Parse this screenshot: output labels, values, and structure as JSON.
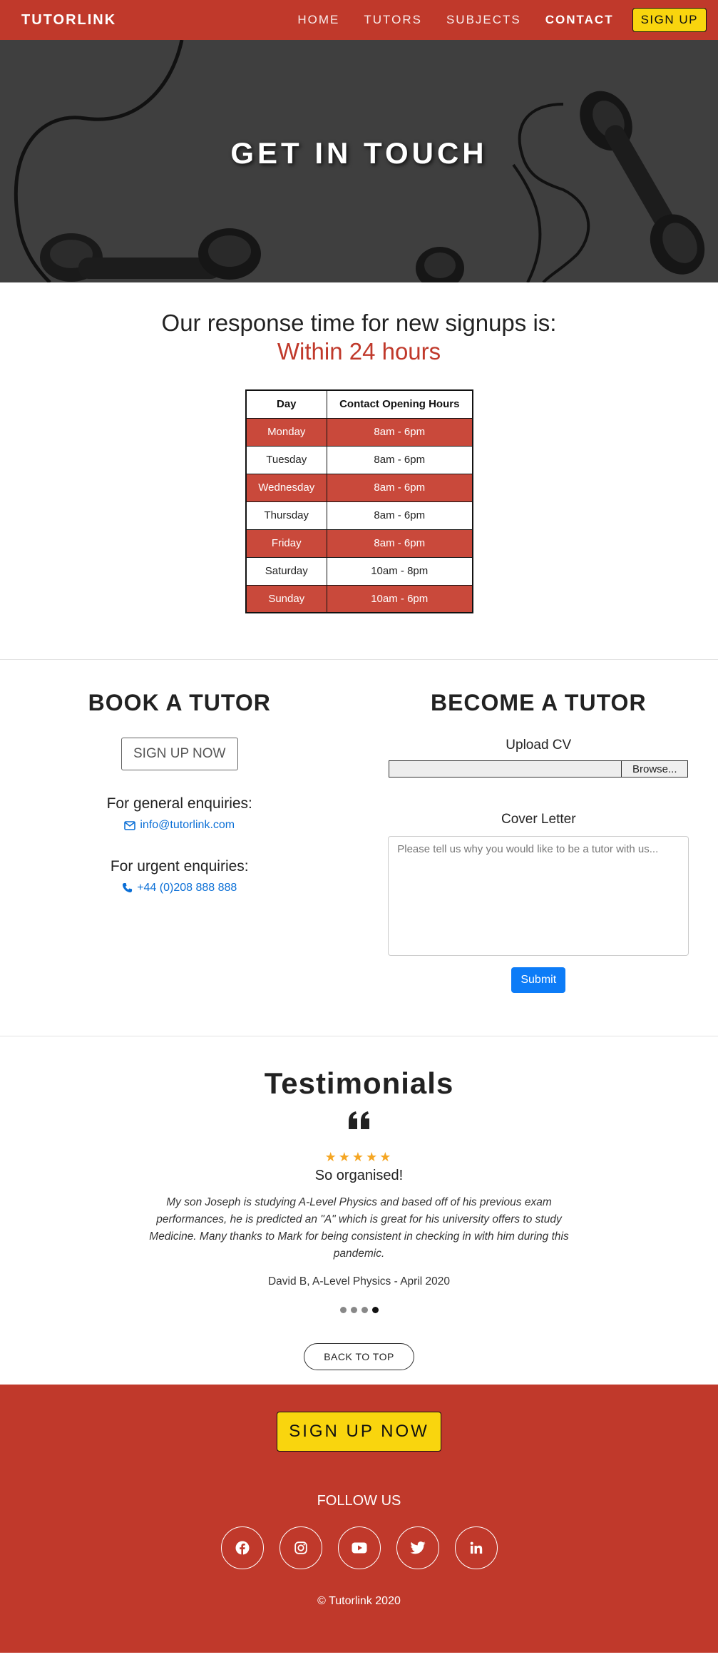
{
  "nav": {
    "brand": "TUTORLINK",
    "links": [
      "HOME",
      "TUTORS",
      "SUBJECTS",
      "CONTACT"
    ],
    "active": "CONTACT",
    "signup": "SIGN UP"
  },
  "hero": {
    "title": "GET IN TOUCH"
  },
  "response": {
    "line1": "Our response time for new signups is:",
    "line2": "Within 24 hours"
  },
  "hours_table": {
    "headers": [
      "Day",
      "Contact Opening Hours"
    ],
    "rows": [
      [
        "Monday",
        "8am - 6pm"
      ],
      [
        "Tuesday",
        "8am - 6pm"
      ],
      [
        "Wednesday",
        "8am - 6pm"
      ],
      [
        "Thursday",
        "8am - 6pm"
      ],
      [
        "Friday",
        "8am - 6pm"
      ],
      [
        "Saturday",
        "10am - 8pm"
      ],
      [
        "Sunday",
        "10am - 6pm"
      ]
    ]
  },
  "book": {
    "title": "BOOK A TUTOR",
    "button": "SIGN UP NOW",
    "general_label": "For general enquiries:",
    "email": "info@tutorlink.com",
    "urgent_label": "For urgent enquiries:",
    "phone": "+44 (0)208 888 888"
  },
  "become": {
    "title": "BECOME A TUTOR",
    "upload_label": "Upload CV",
    "browse": "Browse...",
    "cover_label": "Cover Letter",
    "cover_placeholder": "Please tell us why you would like to be a tutor with us...",
    "submit": "Submit"
  },
  "testimonials": {
    "title": "Testimonials",
    "stars": "★★★★★",
    "heading": "So organised!",
    "text": "My son Joseph is studying A-Level Physics and based off of his previous exam performances, he is predicted an \"A\" which is great for his university offers to study Medicine. Many thanks to Mark for being consistent in checking in with him during this pandemic.",
    "author": "David B, A-Level Physics - April 2020",
    "slide_count": 4,
    "active_slide": 4,
    "back_to_top": "BACK TO TOP"
  },
  "footer": {
    "signup": "SIGN UP NOW",
    "follow": "FOLLOW US",
    "socials": [
      "facebook-icon",
      "instagram-icon",
      "youtube-icon",
      "twitter-icon",
      "linkedin-icon"
    ],
    "copyright": "© Tutorlink 2020"
  },
  "colors": {
    "brand_red": "#c0392b",
    "table_red": "#c9493b",
    "accent_yellow": "#f9d50e",
    "link_blue": "#0b6fd6",
    "submit_blue": "#0d7cf7",
    "star_gold": "#f5a623"
  }
}
